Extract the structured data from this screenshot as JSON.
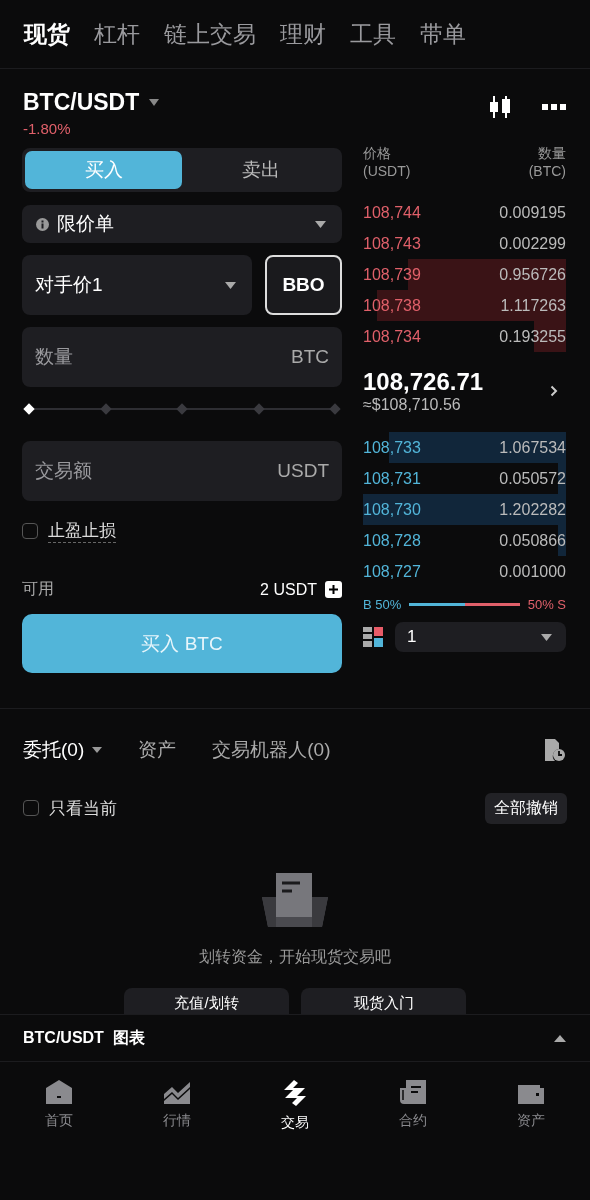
{
  "top_tabs": [
    {
      "label": "现货",
      "selected": true
    },
    {
      "label": "杠杆",
      "selected": false
    },
    {
      "label": "链上交易",
      "selected": false
    },
    {
      "label": "理财",
      "selected": false
    },
    {
      "label": "工具",
      "selected": false
    },
    {
      "label": "带单",
      "selected": false
    }
  ],
  "pair": {
    "name": "BTC/USDT",
    "change": "-1.80%"
  },
  "side_toggle": [
    {
      "label": "买入",
      "selected": true
    },
    {
      "label": "卖出",
      "selected": false
    }
  ],
  "order_type": {
    "label": "限价单"
  },
  "price": {
    "value": "对手价1",
    "bbo": "BBO"
  },
  "quantity": {
    "placeholder": "数量",
    "unit": "BTC"
  },
  "slider": {
    "level": 0
  },
  "amount": {
    "placeholder": "交易额",
    "unit": "USDT"
  },
  "tp_sl": {
    "label": "止盈止损",
    "checked": false
  },
  "available": {
    "label": "可用",
    "value": "2 USDT"
  },
  "buy_button": "买入 BTC",
  "order_book": {
    "price_header": "价格",
    "price_unit": "(USDT)",
    "qty_header": "数量",
    "qty_unit": "(BTC)",
    "asks": [
      {
        "price": "108,744",
        "qty": "0.009195"
      },
      {
        "price": "108,743",
        "qty": "0.002299"
      },
      {
        "price": "108,739",
        "qty": "0.956726"
      },
      {
        "price": "108,738",
        "qty": "1.117263"
      },
      {
        "price": "108,734",
        "qty": "0.193255"
      }
    ],
    "last_price": "108,726.71",
    "last_price_usd": "≈$108,710.56",
    "bids": [
      {
        "price": "108,733",
        "qty": "1.067534"
      },
      {
        "price": "108,731",
        "qty": "0.050572"
      },
      {
        "price": "108,730",
        "qty": "1.202282"
      },
      {
        "price": "108,728",
        "qty": "0.050866"
      },
      {
        "price": "108,727",
        "qty": "0.001000"
      }
    ],
    "buy_ratio": {
      "label": "B 50%",
      "level": 0.5
    },
    "sell_ratio": "50% S",
    "precision": "1"
  },
  "order_tabs": [
    {
      "label": "委托(0)",
      "selected": true
    },
    {
      "label": "资产",
      "selected": false
    },
    {
      "label": "交易机器人(0)",
      "selected": false
    }
  ],
  "only_current": {
    "label": "只看当前",
    "checked": false
  },
  "cancel_all": "全部撤销",
  "empty": {
    "message": "划转资金，开始现货交易吧",
    "buttons": [
      "充值/划转",
      "现货入门"
    ]
  },
  "chart_bar": {
    "title": "BTC/USDT  图表"
  },
  "bottom_nav": [
    {
      "label": "首页",
      "kind": "home",
      "selected": false
    },
    {
      "label": "行情",
      "kind": "market",
      "selected": false
    },
    {
      "label": "交易",
      "kind": "trade",
      "selected": true
    },
    {
      "label": "合约",
      "kind": "futures",
      "selected": false
    },
    {
      "label": "资产",
      "kind": "assets",
      "selected": false
    }
  ]
}
